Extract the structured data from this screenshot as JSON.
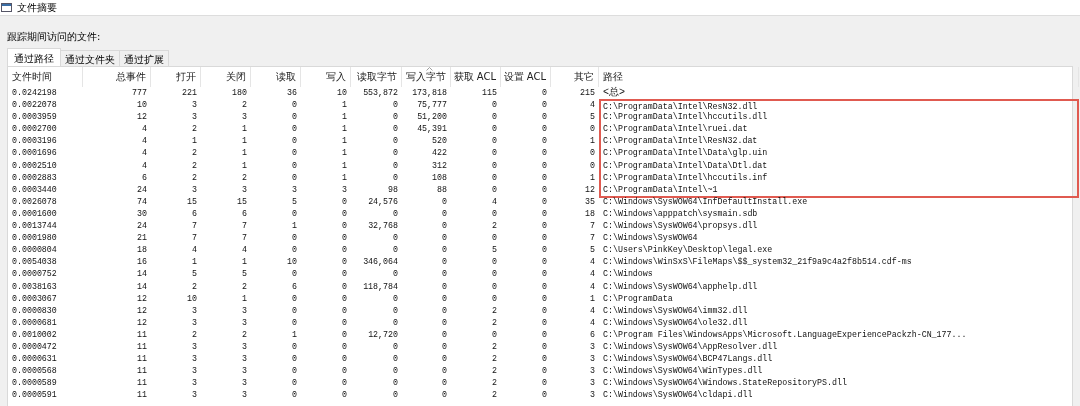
{
  "window": {
    "title": "文件摘要"
  },
  "caption": "跟踪期间访问的文件:",
  "tabs": [
    {
      "label": "通过路径",
      "selected": true
    },
    {
      "label": "通过文件夹",
      "selected": false
    },
    {
      "label": "通过扩展",
      "selected": false
    }
  ],
  "table": {
    "columns": [
      {
        "label": "文件时间",
        "sorted": false
      },
      {
        "label": "总事件",
        "sorted": false
      },
      {
        "label": "打开",
        "sorted": false
      },
      {
        "label": "关闭",
        "sorted": false
      },
      {
        "label": "读取",
        "sorted": false
      },
      {
        "label": "写入",
        "sorted": false
      },
      {
        "label": "读取字节",
        "sorted": false
      },
      {
        "label": "写入字节",
        "sorted": true
      },
      {
        "label": "获取 ACL",
        "sorted": false
      },
      {
        "label": "设置 ACL",
        "sorted": false
      },
      {
        "label": "其它",
        "sorted": false
      },
      {
        "label": "路径",
        "sorted": false
      }
    ],
    "rows": [
      {
        "cells": [
          "0.0242198",
          "777",
          "221",
          "180",
          "36",
          "10",
          "553,872",
          "173,818",
          "115",
          "0",
          "215",
          "<总>"
        ],
        "highlighted": false
      },
      {
        "cells": [
          "0.0022078",
          "10",
          "3",
          "2",
          "0",
          "1",
          "0",
          "75,777",
          "0",
          "0",
          "4",
          "C:\\ProgramData\\Intel\\ResN32.dll"
        ],
        "highlighted": true
      },
      {
        "cells": [
          "0.0003959",
          "12",
          "3",
          "3",
          "0",
          "1",
          "0",
          "51,200",
          "0",
          "0",
          "5",
          "C:\\ProgramData\\Intel\\hccutils.dll"
        ],
        "highlighted": true
      },
      {
        "cells": [
          "0.0002700",
          "4",
          "2",
          "1",
          "0",
          "1",
          "0",
          "45,391",
          "0",
          "0",
          "0",
          "C:\\ProgramData\\Intel\\ruei.dat"
        ],
        "highlighted": true
      },
      {
        "cells": [
          "0.0003196",
          "4",
          "1",
          "1",
          "0",
          "1",
          "0",
          "520",
          "0",
          "0",
          "1",
          "C:\\ProgramData\\Intel\\ResN32.dat"
        ],
        "highlighted": true
      },
      {
        "cells": [
          "0.0001696",
          "4",
          "2",
          "1",
          "0",
          "1",
          "0",
          "422",
          "0",
          "0",
          "0",
          "C:\\ProgramData\\Intel\\Data\\glp.uin"
        ],
        "highlighted": true
      },
      {
        "cells": [
          "0.0002510",
          "4",
          "2",
          "1",
          "0",
          "1",
          "0",
          "312",
          "0",
          "0",
          "0",
          "C:\\ProgramData\\Intel\\Data\\Dtl.dat"
        ],
        "highlighted": true
      },
      {
        "cells": [
          "0.0002883",
          "6",
          "2",
          "2",
          "0",
          "1",
          "0",
          "108",
          "0",
          "0",
          "1",
          "C:\\ProgramData\\Intel\\hccutils.inf"
        ],
        "highlighted": true
      },
      {
        "cells": [
          "0.0003440",
          "24",
          "3",
          "3",
          "3",
          "3",
          "98",
          "88",
          "0",
          "0",
          "12",
          "C:\\ProgramData\\Intel\\~1"
        ],
        "highlighted": true
      },
      {
        "cells": [
          "0.0026078",
          "74",
          "15",
          "15",
          "5",
          "0",
          "24,576",
          "0",
          "4",
          "0",
          "35",
          "C:\\Windows\\SysWOW64\\InfDefaultInstall.exe"
        ],
        "highlighted": false
      },
      {
        "cells": [
          "0.0001600",
          "30",
          "6",
          "6",
          "0",
          "0",
          "0",
          "0",
          "0",
          "0",
          "18",
          "C:\\Windows\\apppatch\\sysmain.sdb"
        ],
        "highlighted": false
      },
      {
        "cells": [
          "0.0013744",
          "24",
          "7",
          "7",
          "1",
          "0",
          "32,768",
          "0",
          "2",
          "0",
          "7",
          "C:\\Windows\\SysWOW64\\propsys.dll"
        ],
        "highlighted": false
      },
      {
        "cells": [
          "0.0001980",
          "21",
          "7",
          "7",
          "0",
          "0",
          "0",
          "0",
          "0",
          "0",
          "7",
          "C:\\Windows\\SysWOW64"
        ],
        "highlighted": false
      },
      {
        "cells": [
          "0.0000804",
          "18",
          "4",
          "4",
          "0",
          "0",
          "0",
          "0",
          "5",
          "0",
          "5",
          "C:\\Users\\PinkKey\\Desktop\\legal.exe"
        ],
        "highlighted": false
      },
      {
        "cells": [
          "0.0054038",
          "16",
          "1",
          "1",
          "10",
          "0",
          "346,064",
          "0",
          "0",
          "0",
          "4",
          "C:\\Windows\\WinSxS\\FileMaps\\$$_system32_21f9a9c4a2f8b514.cdf-ms"
        ],
        "highlighted": false
      },
      {
        "cells": [
          "0.0000752",
          "14",
          "5",
          "5",
          "0",
          "0",
          "0",
          "0",
          "0",
          "0",
          "4",
          "C:\\Windows"
        ],
        "highlighted": false
      },
      {
        "cells": [
          "0.0038163",
          "14",
          "2",
          "2",
          "6",
          "0",
          "118,784",
          "0",
          "0",
          "0",
          "4",
          "C:\\Windows\\SysWOW64\\apphelp.dll"
        ],
        "highlighted": false
      },
      {
        "cells": [
          "0.0003067",
          "12",
          "10",
          "1",
          "0",
          "0",
          "0",
          "0",
          "0",
          "0",
          "1",
          "C:\\ProgramData"
        ],
        "highlighted": false
      },
      {
        "cells": [
          "0.0000830",
          "12",
          "3",
          "3",
          "0",
          "0",
          "0",
          "0",
          "2",
          "0",
          "4",
          "C:\\Windows\\SysWOW64\\imm32.dll"
        ],
        "highlighted": false
      },
      {
        "cells": [
          "0.0000681",
          "12",
          "3",
          "3",
          "0",
          "0",
          "0",
          "0",
          "2",
          "0",
          "4",
          "C:\\Windows\\SysWOW64\\ole32.dll"
        ],
        "highlighted": false
      },
      {
        "cells": [
          "0.0010002",
          "11",
          "2",
          "2",
          "1",
          "0",
          "12,720",
          "0",
          "0",
          "0",
          "6",
          "C:\\Program Files\\WindowsApps\\Microsoft.LanguageExperiencePackzh-CN_177..."
        ],
        "highlighted": false
      },
      {
        "cells": [
          "0.0000472",
          "11",
          "3",
          "3",
          "0",
          "0",
          "0",
          "0",
          "2",
          "0",
          "3",
          "C:\\Windows\\SysWOW64\\AppResolver.dll"
        ],
        "highlighted": false
      },
      {
        "cells": [
          "0.0000631",
          "11",
          "3",
          "3",
          "0",
          "0",
          "0",
          "0",
          "2",
          "0",
          "3",
          "C:\\Windows\\SysWOW64\\BCP47Langs.dll"
        ],
        "highlighted": false
      },
      {
        "cells": [
          "0.0000568",
          "11",
          "3",
          "3",
          "0",
          "0",
          "0",
          "0",
          "2",
          "0",
          "3",
          "C:\\Windows\\SysWOW64\\WinTypes.dll"
        ],
        "highlighted": false
      },
      {
        "cells": [
          "0.0000589",
          "11",
          "3",
          "3",
          "0",
          "0",
          "0",
          "0",
          "2",
          "0",
          "3",
          "C:\\Windows\\SysWOW64\\Windows.StateRepositoryPS.dll"
        ],
        "highlighted": false
      },
      {
        "cells": [
          "0.0000591",
          "11",
          "3",
          "3",
          "0",
          "0",
          "0",
          "0",
          "2",
          "0",
          "3",
          "C:\\Windows\\SysWOW64\\cldapi.dll"
        ],
        "highlighted": false
      }
    ]
  }
}
